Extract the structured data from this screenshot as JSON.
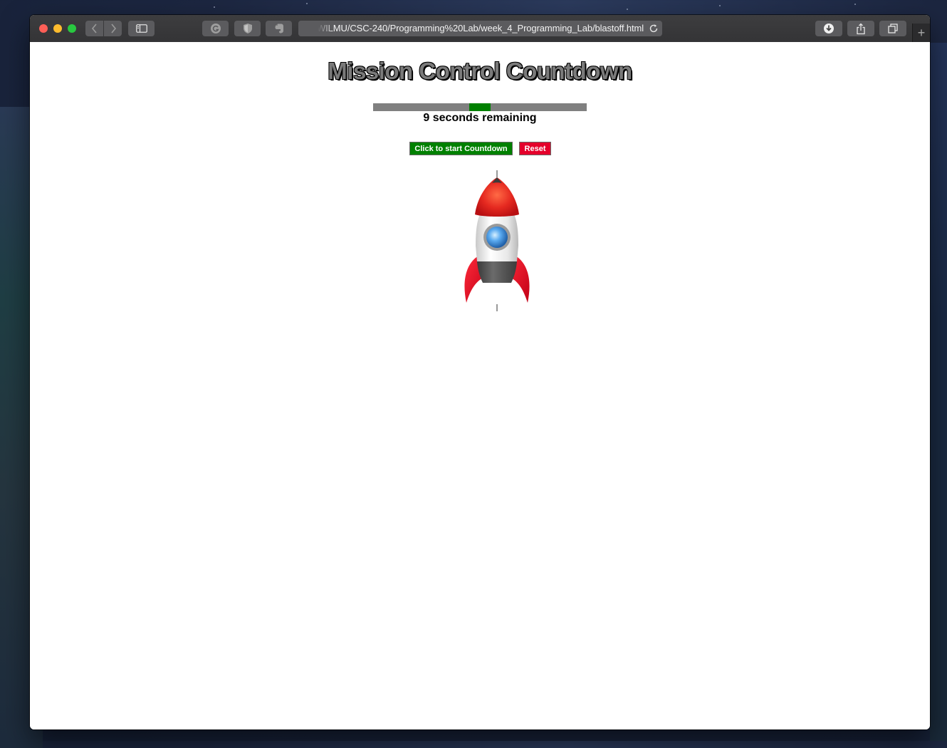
{
  "browser": {
    "url": "WILMU/CSC-240/Programming%20Lab/week_4_Programming_Lab/blastoff.html",
    "new_tab_label": "+"
  },
  "page": {
    "title": "Mission Control Countdown",
    "countdown_text": "9 seconds remaining",
    "progress": {
      "fill_start_fraction": 0.45,
      "fill_fraction": 0.1
    },
    "start_button_label": "Click to start Countdown",
    "reset_button_label": "Reset"
  },
  "colors": {
    "progress_track": "#808080",
    "progress_fill": "#008000",
    "start_button": "#008000",
    "reset_button": "#e4002b",
    "rocket_nose": "#e0201f",
    "rocket_window": "#4a9be0"
  }
}
